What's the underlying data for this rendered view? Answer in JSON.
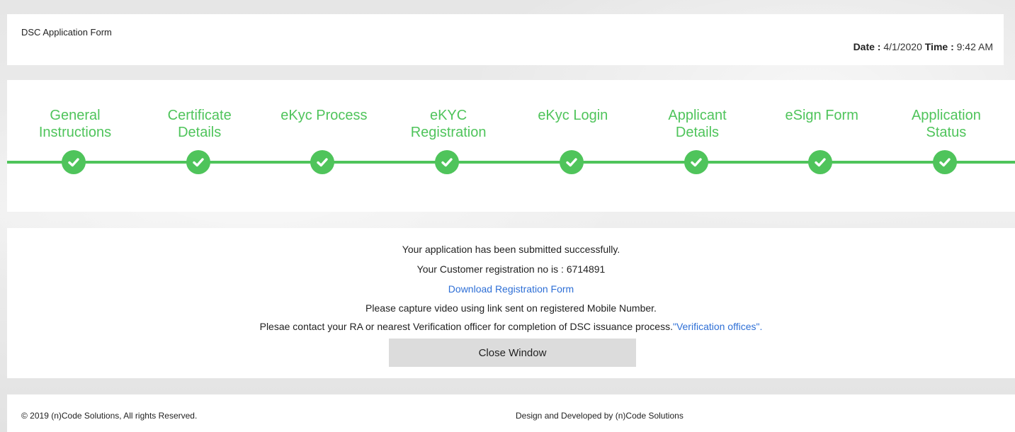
{
  "header": {
    "title": "DSC Application Form",
    "date_label": "Date :",
    "date_value": "4/1/2020",
    "time_label": "Time :",
    "time_value": "9:42 AM"
  },
  "steps": [
    {
      "label_line1": "General",
      "label_line2": "Instructions",
      "completed": true
    },
    {
      "label_line1": "Certificate",
      "label_line2": "Details",
      "completed": true
    },
    {
      "label_line1": "eKyc Process",
      "label_line2": "",
      "completed": true
    },
    {
      "label_line1": "eKYC",
      "label_line2": "Registration",
      "completed": true
    },
    {
      "label_line1": "eKyc Login",
      "label_line2": "",
      "completed": true
    },
    {
      "label_line1": "Applicant",
      "label_line2": "Details",
      "completed": true
    },
    {
      "label_line1": "eSign Form",
      "label_line2": "",
      "completed": true
    },
    {
      "label_line1": "Application",
      "label_line2": "Status",
      "completed": true
    }
  ],
  "colors": {
    "accent_green": "#4fc45b",
    "link_blue": "#2e6fd6",
    "button_gray": "#dcdcdc"
  },
  "message": {
    "line1": "Your application has been submitted successfully.",
    "line2_prefix": "Your Customer registration no is :",
    "registration_no": "6714891",
    "download_link": "Download Registration Form",
    "line4": "Please capture video using link sent on registered Mobile Number.",
    "line5_prefix": "Plesae contact your RA or nearest Verification officer for completion of DSC issuance process.",
    "verification_link": "\"Verification offices\"",
    "line5_suffix": ".",
    "close_button": "Close Window"
  },
  "footer": {
    "copyright": "© 2019 (n)Code Solutions, All rights Reserved.",
    "credits": "Design and Developed by (n)Code Solutions"
  }
}
